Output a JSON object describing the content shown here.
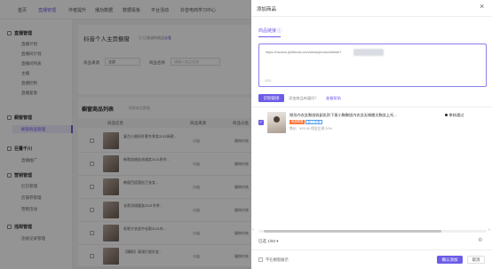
{
  "topnav": {
    "items": [
      "首页",
      "直播管理",
      "作者提升",
      "播功数据",
      "数据看板",
      "平台活动",
      "抖音电商学习中心"
    ],
    "active_index": 1
  },
  "sidebar": {
    "groups": [
      {
        "label": "直播管理",
        "items": [
          "直播计划",
          "直播间计划",
          "直播间列表",
          "主播",
          "直播控制",
          "直播复盘"
        ]
      },
      {
        "label": "橱窗管理",
        "items": [
          "橱窗商品管理"
        ],
        "active_item": "橱窗商品管理"
      },
      {
        "label": "巨量千川",
        "items": [
          "直播推广"
        ]
      },
      {
        "label": "营销管理",
        "items": [
          "红包管理",
          "店铺券管理",
          "营销活动"
        ]
      },
      {
        "label": "违规管理",
        "items": [
          "违规记录管理"
        ]
      }
    ]
  },
  "shop": {
    "title": "抖音个人主页橱窗",
    "tag": "◎ 已收录的商品",
    "link": "去看",
    "filter_source_label": "商品来源",
    "filter_source_value": "全部",
    "filter_name_label": "商品名称",
    "filter_name_placeholder": "请输入商品名称"
  },
  "table": {
    "title": "橱窗商品列表",
    "subtitle": "搜索商品数量",
    "headers": [
      "商品信息",
      "商品来源",
      "商品分类"
    ],
    "rows": [
      {
        "name": "复古小香风外套冬季女2021新款...",
        "source": "小店",
        "category": "服饰内衣"
      },
      {
        "name": "新款加绒连衣裙女2021秋冬...",
        "source": "小店",
        "category": "服饰内衣"
      },
      {
        "name": "韩版百搭宽松卫衣女...",
        "source": "小店",
        "category": "服饰内衣"
      },
      {
        "name": "长款羽绒服女2021冬季...",
        "source": "小店",
        "category": "服饰内衣"
      },
      {
        "name": "毛呢大衣女中长款2021年...",
        "source": "小店",
        "category": "服饰内衣"
      },
      {
        "name": "【爆款】高领打底衫女...",
        "source": "小店",
        "category": "服饰内衣"
      }
    ]
  },
  "drawer": {
    "title": "添加商品",
    "close_icon": "close-icon",
    "tab_label": "商品链接 ⓘ",
    "url_text": "https://haohuo.jinritemai.com/views/product/detail?",
    "url_suffix": "",
    "url_count": "1/20",
    "recognize_button": "识别链接",
    "hint_text": "添加商品有疑问？",
    "hint_link": "查看帮助",
    "result": {
      "title": "隐形内衣女聚拢收副乳防下垂小胸聚拢内衣女无钢圈文胸女上托...",
      "badge": "精选联盟",
      "badge2": "新人专享",
      "price": "售价：¥29.90",
      "commission": "佣金比例 20%",
      "meta": "售价：¥29.90   佣金比例 20%",
      "status": "审核通过"
    },
    "selected_count": "已选 1/50 ▾",
    "footer_checkbox_label": "不在橱窗展示",
    "confirm_button": "确认添加",
    "cancel_button": "取消",
    "accent_color": "#6c5ce7"
  }
}
